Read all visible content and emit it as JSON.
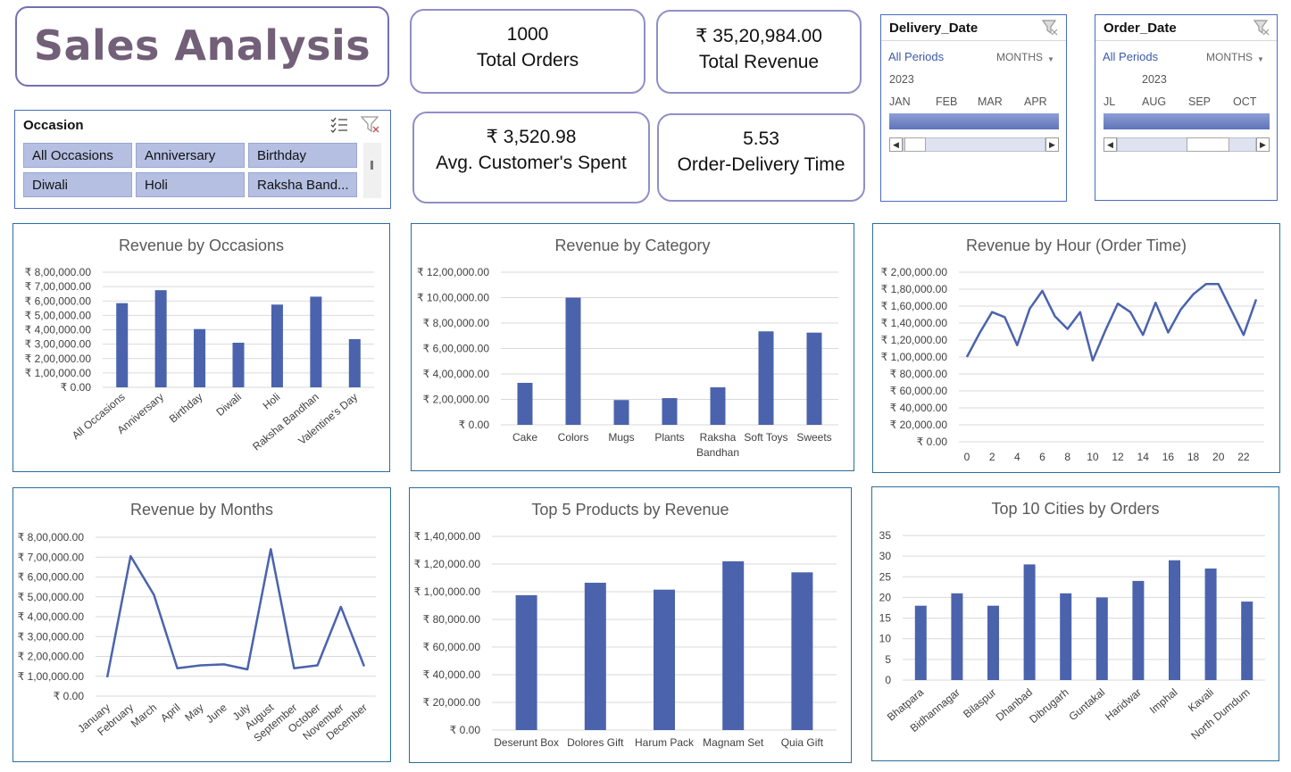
{
  "title": "Sales Analysis",
  "kpis": [
    {
      "value": "1000",
      "label": "Total Orders"
    },
    {
      "value": "₹ 35,20,984.00",
      "label": "Total Revenue"
    },
    {
      "value": "₹ 3,520.98",
      "label": "Avg. Customer's Spent"
    },
    {
      "value": "5.53",
      "label": "Order-Delivery Time"
    }
  ],
  "occasion_slicer": {
    "title": "Occasion",
    "items": [
      "All Occasions",
      "Anniversary",
      "Birthday",
      "Diwali",
      "Holi",
      "Raksha Band..."
    ],
    "selected": "All Occasions"
  },
  "delivery_timeline": {
    "title": "Delivery_Date",
    "periods": "All Periods",
    "level": "MONTHS",
    "year": "2023",
    "months": [
      "JAN",
      "FEB",
      "MAR",
      "APR"
    ]
  },
  "order_timeline": {
    "title": "Order_Date",
    "periods": "All Periods",
    "level": "MONTHS",
    "year": "2023",
    "months": [
      "JL",
      "AUG",
      "SEP",
      "OCT"
    ]
  },
  "colors": {
    "bar": "#4a63ac",
    "card_border": "#8f8fc7",
    "title": "#725f78"
  },
  "chart_data": [
    {
      "id": "occasions",
      "type": "bar",
      "title": "Revenue by Occasions",
      "categories": [
        "All Occasions",
        "Anniversary",
        "Birthday",
        "Diwali",
        "Holi",
        "Raksha Bandhan",
        "Valentine's Day"
      ],
      "values": [
        585000,
        675000,
        405000,
        310000,
        575000,
        630000,
        335000
      ],
      "yticks": [
        "₹ 0.00",
        "₹ 1,00,000.00",
        "₹ 2,00,000.00",
        "₹ 3,00,000.00",
        "₹ 4,00,000.00",
        "₹ 5,00,000.00",
        "₹ 6,00,000.00",
        "₹ 7,00,000.00",
        "₹ 8,00,000.00"
      ],
      "ylim": [
        0,
        800000
      ]
    },
    {
      "id": "category",
      "type": "bar",
      "title": "Revenue by Category",
      "categories": [
        "Cake",
        "Colors",
        "Mugs",
        "Plants",
        "Raksha Bandhan",
        "Soft Toys",
        "Sweets"
      ],
      "values": [
        330000,
        1000000,
        195000,
        210000,
        295000,
        735000,
        725000
      ],
      "yticks": [
        "₹ 0.00",
        "₹ 2,00,000.00",
        "₹ 4,00,000.00",
        "₹ 6,00,000.00",
        "₹ 8,00,000.00",
        "₹ 10,00,000.00",
        "₹ 12,00,000.00"
      ],
      "ylim": [
        0,
        1200000
      ]
    },
    {
      "id": "hour",
      "type": "line",
      "title": "Revenue by Hour (Order Time)",
      "x": [
        0,
        1,
        2,
        3,
        4,
        5,
        6,
        7,
        8,
        9,
        10,
        11,
        12,
        13,
        14,
        15,
        16,
        17,
        18,
        19,
        20,
        21,
        22,
        23
      ],
      "values": [
        100000,
        128000,
        153000,
        147000,
        114000,
        157000,
        178000,
        148000,
        133000,
        153000,
        96000,
        131000,
        163000,
        153000,
        126000,
        164000,
        129000,
        156000,
        174000,
        186000,
        186000,
        156000,
        126000,
        168000
      ],
      "xticks": [
        "0",
        "2",
        "4",
        "6",
        "8",
        "10",
        "12",
        "14",
        "16",
        "18",
        "20",
        "22"
      ],
      "yticks": [
        "₹ 0.00",
        "₹ 20,000.00",
        "₹ 40,000.00",
        "₹ 60,000.00",
        "₹ 80,000.00",
        "₹ 1,00,000.00",
        "₹ 1,20,000.00",
        "₹ 1,40,000.00",
        "₹ 1,60,000.00",
        "₹ 1,80,000.00",
        "₹ 2,00,000.00"
      ],
      "ylim": [
        0,
        200000
      ]
    },
    {
      "id": "months",
      "type": "line",
      "title": "Revenue by Months",
      "categories": [
        "January",
        "February",
        "March",
        "April",
        "May",
        "June",
        "July",
        "August",
        "September",
        "October",
        "November",
        "December"
      ],
      "values": [
        95000,
        705000,
        510000,
        140000,
        155000,
        160000,
        135000,
        740000,
        140000,
        155000,
        450000,
        150000
      ],
      "yticks": [
        "₹ 0.00",
        "₹ 1,00,000.00",
        "₹ 2,00,000.00",
        "₹ 3,00,000.00",
        "₹ 4,00,000.00",
        "₹ 5,00,000.00",
        "₹ 6,00,000.00",
        "₹ 7,00,000.00",
        "₹ 8,00,000.00"
      ],
      "ylim": [
        0,
        800000
      ]
    },
    {
      "id": "products",
      "type": "bar",
      "title": "Top 5 Products by Revenue",
      "categories": [
        "Deserunt Box",
        "Dolores Gift",
        "Harum Pack",
        "Magnam Set",
        "Quia Gift"
      ],
      "values": [
        97500,
        106500,
        101500,
        122000,
        114000
      ],
      "yticks": [
        "₹ 0.00",
        "₹ 20,000.00",
        "₹ 40,000.00",
        "₹ 60,000.00",
        "₹ 80,000.00",
        "₹ 1,00,000.00",
        "₹ 1,20,000.00",
        "₹ 1,40,000.00"
      ],
      "ylim": [
        0,
        140000
      ]
    },
    {
      "id": "cities",
      "type": "bar",
      "title": "Top 10 Cities by Orders",
      "categories": [
        "Bhatpara",
        "Bidhannagar",
        "Bilaspur",
        "Dhanbad",
        "Dibrugarh",
        "Guntakal",
        "Haridwar",
        "Imphal",
        "Kavali",
        "North Dumdum"
      ],
      "values": [
        18,
        21,
        18,
        28,
        21,
        20,
        24,
        29,
        27,
        19
      ],
      "yticks": [
        "0",
        "5",
        "10",
        "15",
        "20",
        "25",
        "30",
        "35"
      ],
      "ylim": [
        0,
        35
      ]
    }
  ]
}
